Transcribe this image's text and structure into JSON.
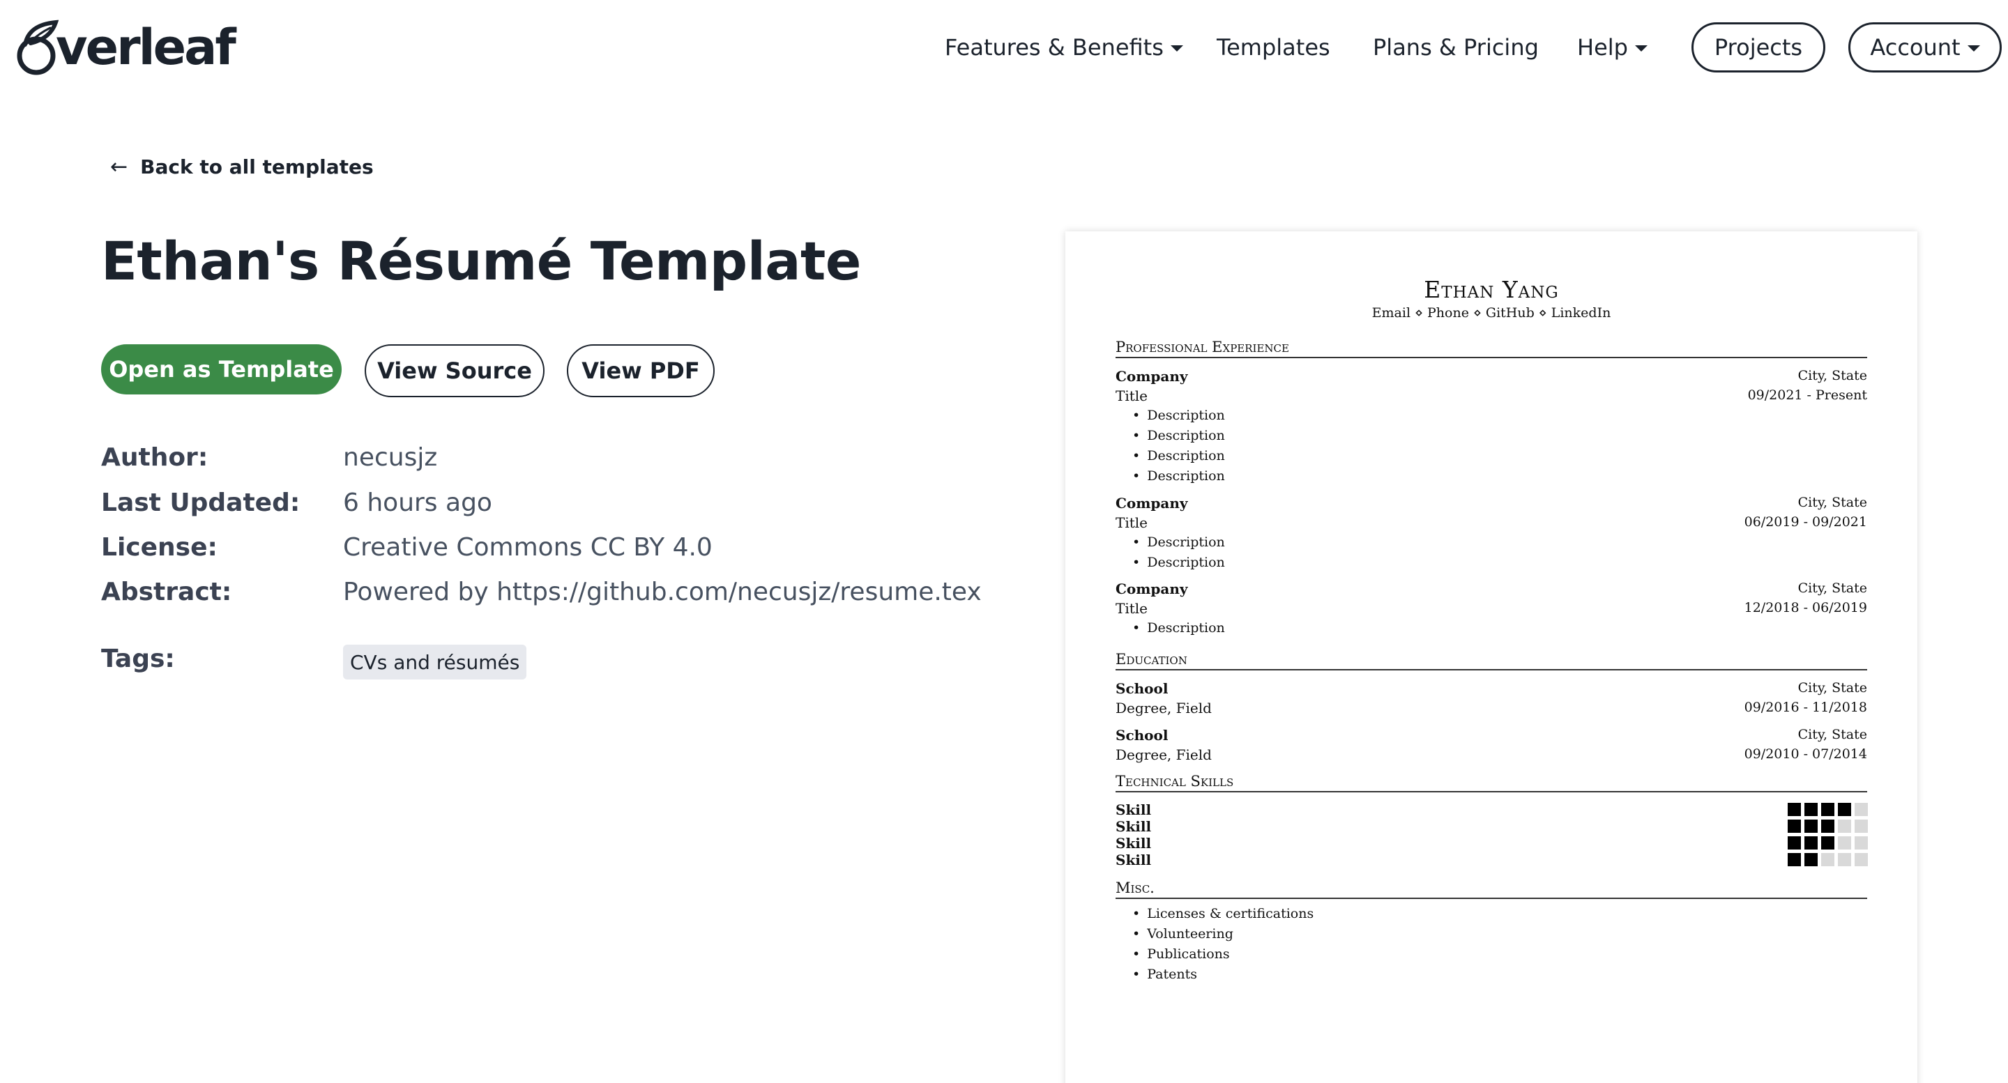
{
  "nav": {
    "logo_text": "verleaf",
    "features": "Features & Benefits",
    "templates": "Templates",
    "pricing": "Plans & Pricing",
    "help": "Help",
    "projects": "Projects",
    "account": "Account"
  },
  "page": {
    "back": "Back to all templates",
    "title": "Ethan's Résumé Template",
    "open_template": "Open as Template",
    "view_source": "View Source",
    "view_pdf": "View PDF"
  },
  "meta": {
    "author_label": "Author:",
    "author": "necusjz",
    "updated_label": "Last Updated:",
    "updated": "6 hours ago",
    "license_label": "License:",
    "license": "Creative Commons CC BY 4.0",
    "abstract_label": "Abstract:",
    "abstract": "Powered by https://github.com/necusjz/resume.tex",
    "tags_label": "Tags:",
    "tag": "CVs and résumés"
  },
  "resume": {
    "name": "Ethan Yang",
    "contact": "Email ⋄ Phone ⋄ GitHub ⋄ LinkedIn",
    "sec_experience": "Professional Experience",
    "sec_education": "Education",
    "sec_skills": "Technical Skills",
    "sec_misc": "Misc.",
    "company": "Company",
    "title": "Title",
    "city_state": "City, State",
    "description": "Description",
    "date1": "09/2021 - Present",
    "date2": "06/2019 - 09/2021",
    "date3": "12/2018 - 06/2019",
    "school": "School",
    "degree": "Degree, Field",
    "edu_date1": "09/2016 - 11/2018",
    "edu_date2": "09/2010 - 07/2014",
    "skill": "Skill",
    "skill_levels": [
      4,
      3,
      3,
      2
    ],
    "skill_max": 5,
    "misc": [
      "Licenses & certifications",
      "Volunteering",
      "Publications",
      "Patents"
    ]
  }
}
